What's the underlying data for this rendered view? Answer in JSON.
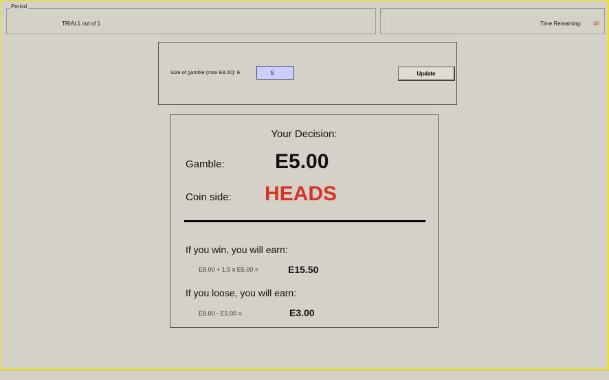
{
  "header": {
    "period_legend": "Period",
    "period_text": "TRIAL1   out of   1",
    "time_label": "Time Remaining:",
    "time_value": "46"
  },
  "gamble_form": {
    "label": "Size of gamble (max E8.00):  E",
    "input_value": "5",
    "update_label": "Update"
  },
  "decision": {
    "title": "Your Decision:",
    "gamble_label": "Gamble:",
    "gamble_value": "E5.00",
    "coin_label": "Coin side:",
    "coin_value": "HEADS",
    "win_label": "If you win, you will earn:",
    "win_formula": "E8.00 + 1.5 x E5.00 =",
    "win_value": "E15.50",
    "lose_label": "If you loose, you will earn:",
    "lose_formula": "E8.00 - E5.00 =",
    "lose_value": "E3.00"
  },
  "colors": {
    "accent_red": "#d93224",
    "border_yellow": "#f2e400",
    "input_bg": "#ccccff"
  }
}
